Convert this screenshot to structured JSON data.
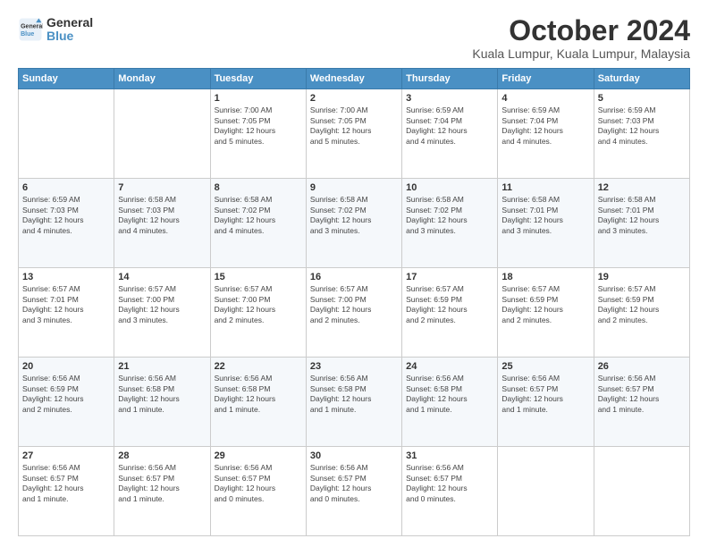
{
  "logo": {
    "line1": "General",
    "line2": "Blue"
  },
  "title": "October 2024",
  "subtitle": "Kuala Lumpur, Kuala Lumpur, Malaysia",
  "days_of_week": [
    "Sunday",
    "Monday",
    "Tuesday",
    "Wednesday",
    "Thursday",
    "Friday",
    "Saturday"
  ],
  "weeks": [
    [
      {
        "day": "",
        "info": ""
      },
      {
        "day": "",
        "info": ""
      },
      {
        "day": "1",
        "info": "Sunrise: 7:00 AM\nSunset: 7:05 PM\nDaylight: 12 hours\nand 5 minutes."
      },
      {
        "day": "2",
        "info": "Sunrise: 7:00 AM\nSunset: 7:05 PM\nDaylight: 12 hours\nand 5 minutes."
      },
      {
        "day": "3",
        "info": "Sunrise: 6:59 AM\nSunset: 7:04 PM\nDaylight: 12 hours\nand 4 minutes."
      },
      {
        "day": "4",
        "info": "Sunrise: 6:59 AM\nSunset: 7:04 PM\nDaylight: 12 hours\nand 4 minutes."
      },
      {
        "day": "5",
        "info": "Sunrise: 6:59 AM\nSunset: 7:03 PM\nDaylight: 12 hours\nand 4 minutes."
      }
    ],
    [
      {
        "day": "6",
        "info": "Sunrise: 6:59 AM\nSunset: 7:03 PM\nDaylight: 12 hours\nand 4 minutes."
      },
      {
        "day": "7",
        "info": "Sunrise: 6:58 AM\nSunset: 7:03 PM\nDaylight: 12 hours\nand 4 minutes."
      },
      {
        "day": "8",
        "info": "Sunrise: 6:58 AM\nSunset: 7:02 PM\nDaylight: 12 hours\nand 4 minutes."
      },
      {
        "day": "9",
        "info": "Sunrise: 6:58 AM\nSunset: 7:02 PM\nDaylight: 12 hours\nand 3 minutes."
      },
      {
        "day": "10",
        "info": "Sunrise: 6:58 AM\nSunset: 7:02 PM\nDaylight: 12 hours\nand 3 minutes."
      },
      {
        "day": "11",
        "info": "Sunrise: 6:58 AM\nSunset: 7:01 PM\nDaylight: 12 hours\nand 3 minutes."
      },
      {
        "day": "12",
        "info": "Sunrise: 6:58 AM\nSunset: 7:01 PM\nDaylight: 12 hours\nand 3 minutes."
      }
    ],
    [
      {
        "day": "13",
        "info": "Sunrise: 6:57 AM\nSunset: 7:01 PM\nDaylight: 12 hours\nand 3 minutes."
      },
      {
        "day": "14",
        "info": "Sunrise: 6:57 AM\nSunset: 7:00 PM\nDaylight: 12 hours\nand 3 minutes."
      },
      {
        "day": "15",
        "info": "Sunrise: 6:57 AM\nSunset: 7:00 PM\nDaylight: 12 hours\nand 2 minutes."
      },
      {
        "day": "16",
        "info": "Sunrise: 6:57 AM\nSunset: 7:00 PM\nDaylight: 12 hours\nand 2 minutes."
      },
      {
        "day": "17",
        "info": "Sunrise: 6:57 AM\nSunset: 6:59 PM\nDaylight: 12 hours\nand 2 minutes."
      },
      {
        "day": "18",
        "info": "Sunrise: 6:57 AM\nSunset: 6:59 PM\nDaylight: 12 hours\nand 2 minutes."
      },
      {
        "day": "19",
        "info": "Sunrise: 6:57 AM\nSunset: 6:59 PM\nDaylight: 12 hours\nand 2 minutes."
      }
    ],
    [
      {
        "day": "20",
        "info": "Sunrise: 6:56 AM\nSunset: 6:59 PM\nDaylight: 12 hours\nand 2 minutes."
      },
      {
        "day": "21",
        "info": "Sunrise: 6:56 AM\nSunset: 6:58 PM\nDaylight: 12 hours\nand 1 minute."
      },
      {
        "day": "22",
        "info": "Sunrise: 6:56 AM\nSunset: 6:58 PM\nDaylight: 12 hours\nand 1 minute."
      },
      {
        "day": "23",
        "info": "Sunrise: 6:56 AM\nSunset: 6:58 PM\nDaylight: 12 hours\nand 1 minute."
      },
      {
        "day": "24",
        "info": "Sunrise: 6:56 AM\nSunset: 6:58 PM\nDaylight: 12 hours\nand 1 minute."
      },
      {
        "day": "25",
        "info": "Sunrise: 6:56 AM\nSunset: 6:57 PM\nDaylight: 12 hours\nand 1 minute."
      },
      {
        "day": "26",
        "info": "Sunrise: 6:56 AM\nSunset: 6:57 PM\nDaylight: 12 hours\nand 1 minute."
      }
    ],
    [
      {
        "day": "27",
        "info": "Sunrise: 6:56 AM\nSunset: 6:57 PM\nDaylight: 12 hours\nand 1 minute."
      },
      {
        "day": "28",
        "info": "Sunrise: 6:56 AM\nSunset: 6:57 PM\nDaylight: 12 hours\nand 1 minute."
      },
      {
        "day": "29",
        "info": "Sunrise: 6:56 AM\nSunset: 6:57 PM\nDaylight: 12 hours\nand 0 minutes."
      },
      {
        "day": "30",
        "info": "Sunrise: 6:56 AM\nSunset: 6:57 PM\nDaylight: 12 hours\nand 0 minutes."
      },
      {
        "day": "31",
        "info": "Sunrise: 6:56 AM\nSunset: 6:57 PM\nDaylight: 12 hours\nand 0 minutes."
      },
      {
        "day": "",
        "info": ""
      },
      {
        "day": "",
        "info": ""
      }
    ]
  ]
}
